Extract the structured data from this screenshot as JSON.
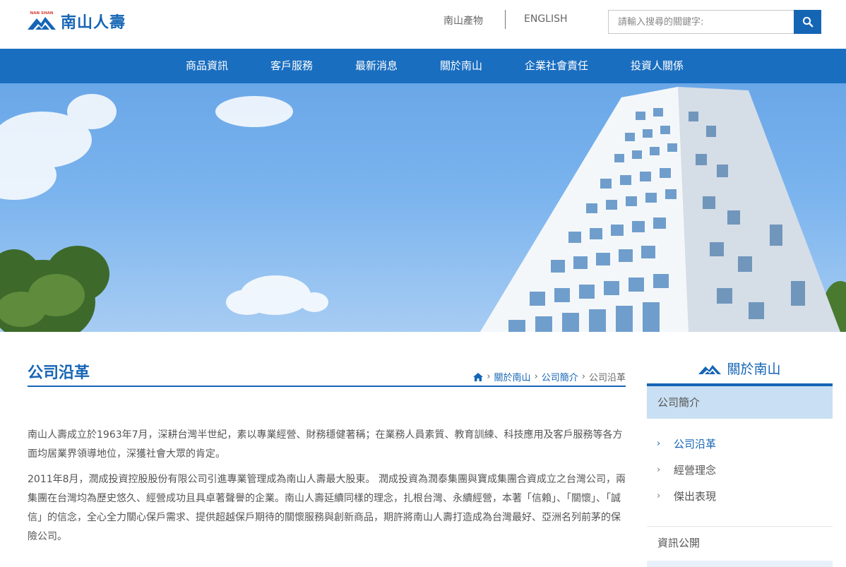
{
  "header": {
    "logo_mark_text": "NAN SHAN",
    "logo_text": "南山人壽",
    "link_property": "南山產物",
    "link_english": "ENGLISH",
    "search_placeholder": "請輸入搜尋的關鍵字:"
  },
  "nav": {
    "items": [
      {
        "label": "商品資訊"
      },
      {
        "label": "客戶服務"
      },
      {
        "label": "最新消息"
      },
      {
        "label": "關於南山"
      },
      {
        "label": "企業社會責任"
      },
      {
        "label": "投資人關係"
      }
    ]
  },
  "main": {
    "title": "公司沿革",
    "breadcrumb": {
      "about": "關於南山",
      "profile": "公司簡介",
      "current": "公司沿革"
    },
    "paragraphs": [
      "南山人壽成立於1963年7月，深耕台灣半世紀，素以專業經營、財務穩健著稱；在業務人員素質、教育訓練、科技應用及客戶服務等各方面均居業界領導地位，深獲社會大眾的肯定。",
      "2011年8月，潤成投資控股股份有限公司引進專業管理成為南山人壽最大股東。 潤成投資為潤泰集團與寶成集團合資成立之台灣公司，兩集團在台灣均為歷史悠久、經營成功且具卓著聲譽的企業。南山人壽延續同樣的理念，扎根台灣、永續經營，本著「信賴」、「關懷」、「誠信」的信念，全心全力關心保戶需求、提供超越保戶期待的關懷服務與創新商品，期許將南山人壽打造成為台灣最好、亞洲名列前茅的保險公司。"
    ]
  },
  "sidebar": {
    "title": "關於南山",
    "section": "公司簡介",
    "items": [
      {
        "label": "公司沿革"
      },
      {
        "label": "經營理念"
      },
      {
        "label": "傑出表現"
      }
    ],
    "section2": "資訊公開"
  },
  "colors": {
    "brand_blue": "#1565b5",
    "nav_blue": "#1a6ec0",
    "sidebar_highlight": "#c9dff3"
  }
}
